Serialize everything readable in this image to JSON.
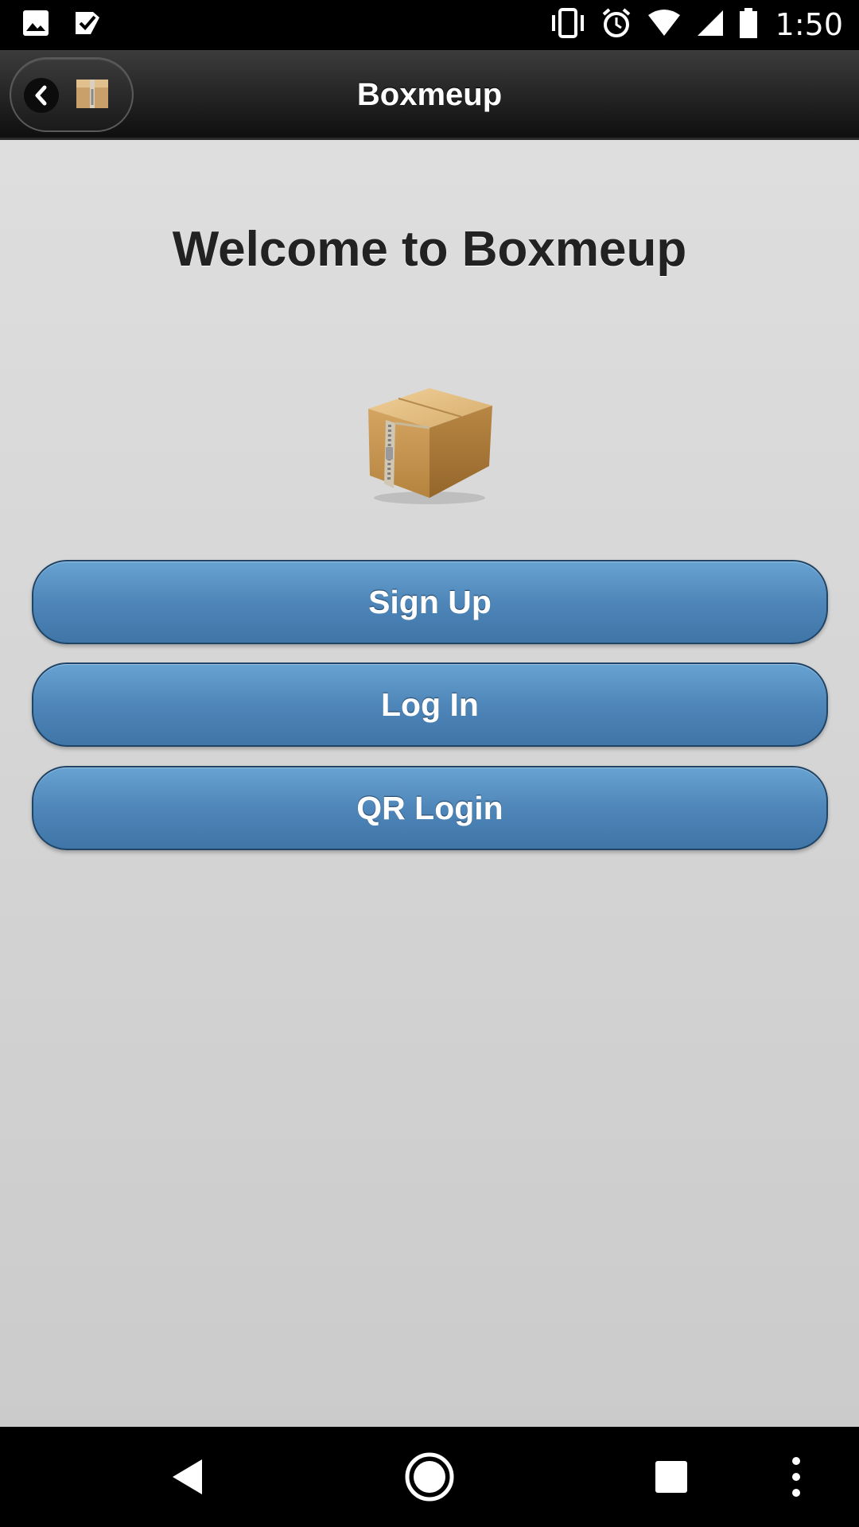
{
  "status_bar": {
    "time": "1:50",
    "left_icons": [
      "gallery-icon",
      "check-icon"
    ],
    "right_icons": [
      "vibrate-icon",
      "alarm-icon",
      "wifi-icon",
      "signal-icon",
      "battery-icon"
    ]
  },
  "header": {
    "title": "Boxmeup",
    "back_icon": "chevron-left-icon",
    "app_icon": "box-icon"
  },
  "main": {
    "welcome": "Welcome to Boxmeup",
    "logo_icon": "cardboard-box-icon",
    "buttons": [
      {
        "label": "Sign Up"
      },
      {
        "label": "Log In"
      },
      {
        "label": "QR Login"
      }
    ]
  },
  "nav_bar": {
    "icons": [
      "back-triangle-icon",
      "home-circle-icon",
      "recents-square-icon",
      "more-vert-icon"
    ]
  },
  "colors": {
    "button_blue": "#4f86b9",
    "header_dark": "#1a1a1a",
    "background": "#d5d5d5"
  }
}
